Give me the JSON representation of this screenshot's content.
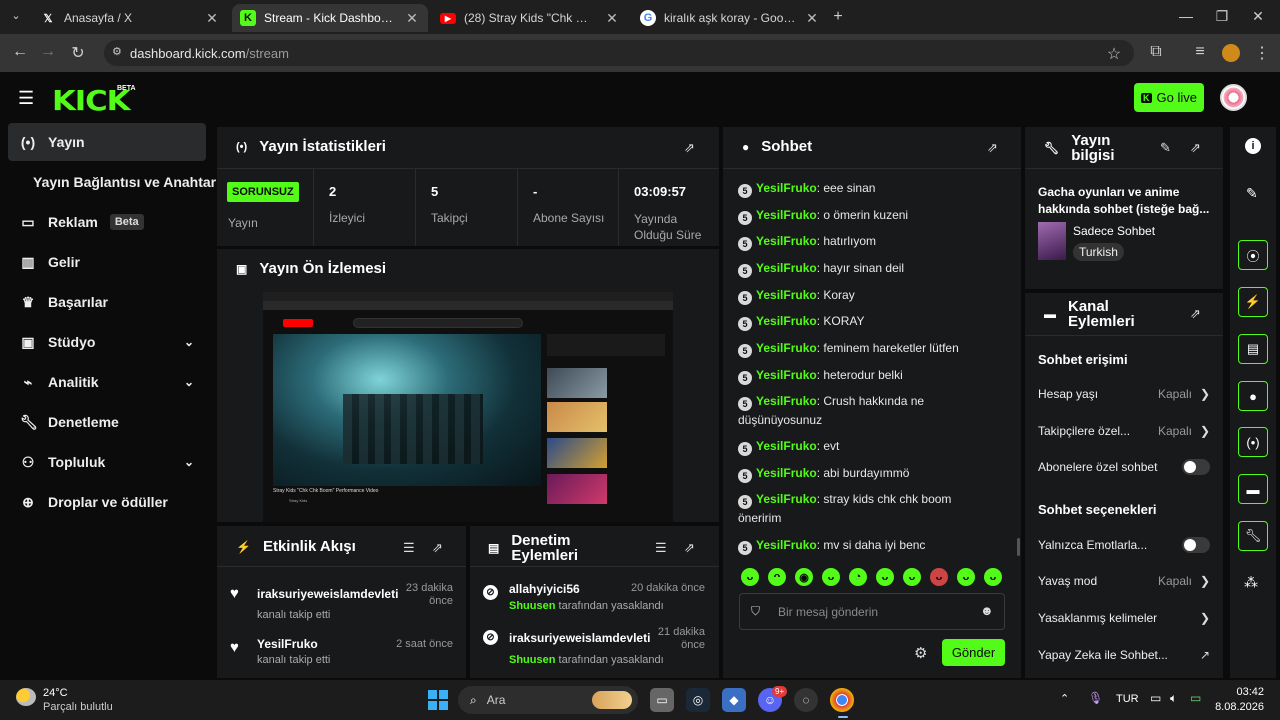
{
  "browser": {
    "tabs": [
      {
        "title": "Anasayfa / X",
        "icon": "x-logo-icon"
      },
      {
        "title": "Stream - Kick Dashboard",
        "icon": "kick-logo-icon"
      },
      {
        "title": "(28) Stray Kids \"Chk Chk Boom\"",
        "icon": "youtube-icon"
      },
      {
        "title": "kiralık aşk koray - Google'da Ara",
        "icon": "google-icon"
      }
    ],
    "url_host": "dashboard.kick.com",
    "url_path": "/stream"
  },
  "header": {
    "logo": "KICK",
    "logo_badge": "BETA",
    "go_live_label": "Go live"
  },
  "sidebar": {
    "items": [
      {
        "label": "Yayın",
        "icon": "broadcast-icon",
        "active": true
      },
      {
        "label": "Yayın Bağlantısı ve Anahtarı"
      },
      {
        "label": "Reklam",
        "badge": "Beta",
        "icon": "ad-icon"
      },
      {
        "label": "Gelir",
        "icon": "chart-icon"
      },
      {
        "label": "Başarılar",
        "icon": "trophy-icon"
      },
      {
        "label": "Stüdyo",
        "icon": "studio-icon"
      },
      {
        "label": "Analitik",
        "icon": "analytics-icon"
      },
      {
        "label": "Denetleme",
        "icon": "wrench-icon"
      },
      {
        "label": "Topluluk",
        "icon": "community-icon"
      },
      {
        "label": "Droplar ve ödüller",
        "icon": "rewards-icon"
      }
    ]
  },
  "stats": {
    "title": "Yayın İstatistikleri",
    "status_badge": "SORUNSUZ",
    "status_label": "Yayın",
    "viewers_value": "2",
    "viewers_label": "İzleyici",
    "followers_value": "5",
    "followers_label": "Takipçi",
    "subs_value": "-",
    "subs_label": "Abone Sayısı",
    "uptime_value": "03:09:57",
    "uptime_label": "Yayında Olduğu Süre"
  },
  "preview": {
    "title": "Yayın Ön İzlemesi",
    "video_title": "Stray Kids \"Chk Chk Boom\" Performance Video",
    "channel": "Stray Kids"
  },
  "activity": {
    "title": "Etkinlik Akışı",
    "items": [
      {
        "user": "iraksuriyeweislamdevleti",
        "action": "kanalı takip etti",
        "time": "23 dakika önce"
      },
      {
        "user": "YesilFruko",
        "action": "kanalı takip etti",
        "time": "2 saat önce"
      }
    ]
  },
  "moderation": {
    "title": "Denetim Eylemleri",
    "items": [
      {
        "user": "allahyiyici56",
        "mod": "Shuusen",
        "action": "tarafından yasaklandı",
        "time": "20 dakika önce"
      },
      {
        "user": "iraksuriyeweislamdevleti",
        "mod": "Shuusen",
        "action": "tarafından yasaklandı",
        "time": "21 dakika önce"
      }
    ]
  },
  "chat": {
    "title": "Sohbet",
    "badge": "5",
    "messages": [
      {
        "user": "YesilFruko",
        "text": "eee sinan"
      },
      {
        "user": "YesilFruko",
        "text": "o ömerin kuzeni"
      },
      {
        "user": "YesilFruko",
        "text": "hatırlıyom"
      },
      {
        "user": "YesilFruko",
        "text": "hayır sinan deil"
      },
      {
        "user": "YesilFruko",
        "text": "Koray"
      },
      {
        "user": "YesilFruko",
        "text": "KORAY"
      },
      {
        "user": "YesilFruko",
        "text": "feminem hareketler lütfen"
      },
      {
        "user": "YesilFruko",
        "text": "heterodur belki"
      },
      {
        "user": "YesilFruko",
        "text": "Crush hakkında ne düşünüyosunuz"
      },
      {
        "user": "YesilFruko",
        "text": "evt"
      },
      {
        "user": "YesilFruko",
        "text": "abi burdayımmö"
      },
      {
        "user": "YesilFruko",
        "text": "stray kids chk chk boom öneririm"
      },
      {
        "user": "YesilFruko",
        "text": "mv si daha iyi benc"
      }
    ],
    "input_placeholder": "Bir mesaj gönderin",
    "send_label": "Gönder"
  },
  "stream_info": {
    "title": "Yayın bilgisi",
    "stream_title": "Gacha oyunları ve anime hakkında sohbet (isteğe bağ...",
    "category": "Sadece Sohbet",
    "language": "Turkish"
  },
  "channel_actions": {
    "title": "Kanal Eylemleri",
    "chat_access_heading": "Sohbet erişimi",
    "account_age_label": "Hesap yaşı",
    "account_age_value": "Kapalı",
    "followers_only_label": "Takipçilere özel...",
    "followers_only_value": "Kapalı",
    "subs_only_label": "Abonelere özel sohbet",
    "chat_options_heading": "Sohbet seçenekleri",
    "emotes_only_label": "Yalnızca Emotlarla...",
    "slow_mode_label": "Yavaş mod",
    "slow_mode_value": "Kapalı",
    "banned_words_label": "Yasaklanmış kelimeler",
    "ai_label": "Yapay Zeka ile Sohbet..."
  },
  "taskbar": {
    "weather_temp": "24°C",
    "weather_desc": "Parçalı bulutlu",
    "search_label": "Ara",
    "lang": "TUR",
    "time": "03:42",
    "date": "8.08.2026",
    "discord_badge": "9+"
  },
  "colors": {
    "accent": "#53fc18",
    "panel": "#18191b",
    "background": "#0b0b0c"
  }
}
